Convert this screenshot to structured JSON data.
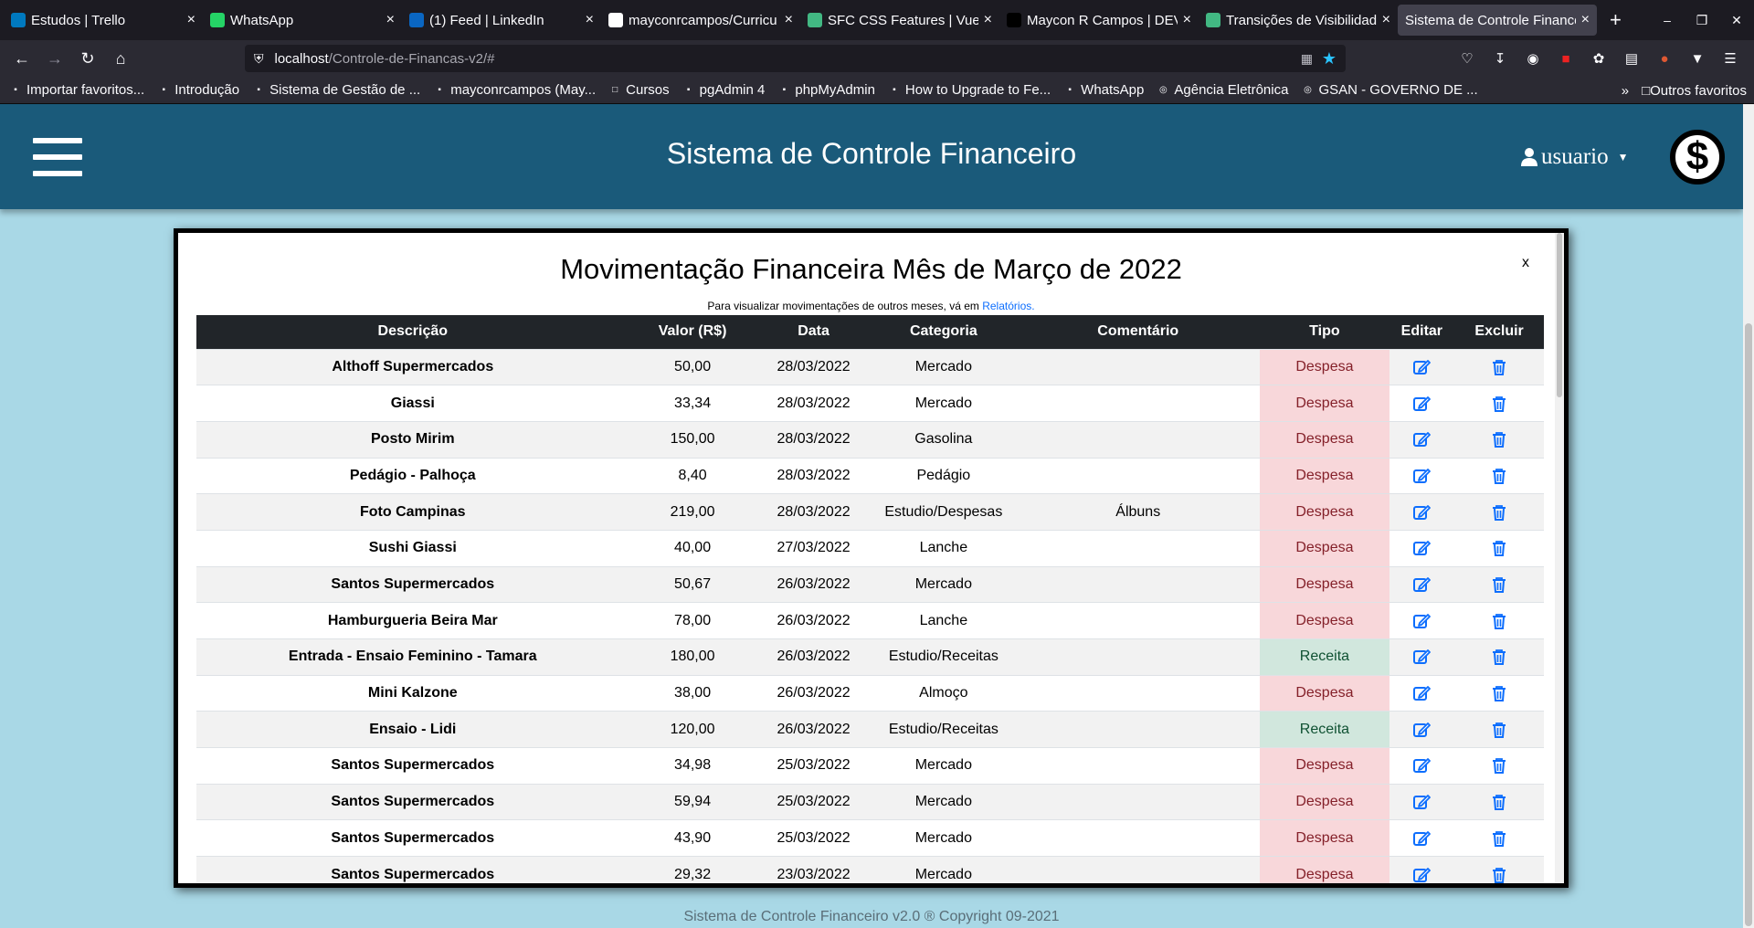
{
  "browser": {
    "tabs": [
      {
        "label": "Estudos | Trello",
        "icon": "trello-icon",
        "color": "#0079bf"
      },
      {
        "label": "WhatsApp",
        "icon": "whatsapp-icon",
        "color": "#25d366"
      },
      {
        "label": "(1) Feed | LinkedIn",
        "icon": "linkedin-icon",
        "color": "#0a66c2"
      },
      {
        "label": "mayconrcampos/Curricu",
        "icon": "github-icon",
        "color": "#ffffff"
      },
      {
        "label": "SFC CSS Features | Vue.js",
        "icon": "vue-icon",
        "color": "#42b883"
      },
      {
        "label": "Maycon R Campos | DEV Ful",
        "icon": "dev-icon",
        "color": "#000000"
      },
      {
        "label": "Transições de Visibilidad",
        "icon": "vue-icon",
        "color": "#42b883"
      },
      {
        "label": "Sistema de Controle Finance",
        "icon": "",
        "color": ""
      }
    ],
    "url_host": "localhost",
    "url_path": "/Controle-de-Financas-v2/#",
    "bookmarks": [
      {
        "label": "Importar favoritos...",
        "icon": "import-icon"
      },
      {
        "label": "Introdução",
        "icon": "firefox-icon"
      },
      {
        "label": "Sistema de Gestão de ...",
        "icon": "arrow-icon"
      },
      {
        "label": "mayconrcampos (May...",
        "icon": "github-icon"
      },
      {
        "label": "Cursos",
        "icon": "folder-icon"
      },
      {
        "label": "pgAdmin 4",
        "icon": "pg-icon"
      },
      {
        "label": "phpMyAdmin",
        "icon": "pma-icon"
      },
      {
        "label": "How to Upgrade to Fe...",
        "icon": "fedora-icon"
      },
      {
        "label": "WhatsApp",
        "icon": "whatsapp-icon"
      },
      {
        "label": "Agência Eletrônica",
        "icon": "globe-icon"
      },
      {
        "label": "GSAN - GOVERNO DE ...",
        "icon": "globe-icon"
      }
    ],
    "other_bookmarks": "Outros favoritos"
  },
  "app": {
    "title": "Sistema de Controle Financeiro",
    "user": "usuario",
    "logo_symbol": "$"
  },
  "modal": {
    "title": "Movimentação Financeira Mês de Março de 2022",
    "close": "x",
    "subtitle_prefix": "Para visualizar movimentações de outros meses, vá em ",
    "subtitle_link": "Relatórios.",
    "columns": [
      "Descrição",
      "Valor (R$)",
      "Data",
      "Categoria",
      "Comentário",
      "Tipo",
      "Editar",
      "Excluir"
    ],
    "rows": [
      {
        "descricao": "Althoff Supermercados",
        "valor": "50,00",
        "data": "28/03/2022",
        "categoria": "Mercado",
        "comentario": "",
        "tipo": "Despesa"
      },
      {
        "descricao": "Giassi",
        "valor": "33,34",
        "data": "28/03/2022",
        "categoria": "Mercado",
        "comentario": "",
        "tipo": "Despesa"
      },
      {
        "descricao": "Posto Mirim",
        "valor": "150,00",
        "data": "28/03/2022",
        "categoria": "Gasolina",
        "comentario": "",
        "tipo": "Despesa"
      },
      {
        "descricao": "Pedágio - Palhoça",
        "valor": "8,40",
        "data": "28/03/2022",
        "categoria": "Pedágio",
        "comentario": "",
        "tipo": "Despesa"
      },
      {
        "descricao": "Foto Campinas",
        "valor": "219,00",
        "data": "28/03/2022",
        "categoria": "Estudio/Despesas",
        "comentario": "Álbuns",
        "tipo": "Despesa"
      },
      {
        "descricao": "Sushi Giassi",
        "valor": "40,00",
        "data": "27/03/2022",
        "categoria": "Lanche",
        "comentario": "",
        "tipo": "Despesa"
      },
      {
        "descricao": "Santos Supermercados",
        "valor": "50,67",
        "data": "26/03/2022",
        "categoria": "Mercado",
        "comentario": "",
        "tipo": "Despesa"
      },
      {
        "descricao": "Hamburgueria Beira Mar",
        "valor": "78,00",
        "data": "26/03/2022",
        "categoria": "Lanche",
        "comentario": "",
        "tipo": "Despesa"
      },
      {
        "descricao": "Entrada - Ensaio Feminino - Tamara",
        "valor": "180,00",
        "data": "26/03/2022",
        "categoria": "Estudio/Receitas",
        "comentario": "",
        "tipo": "Receita"
      },
      {
        "descricao": "Mini Kalzone",
        "valor": "38,00",
        "data": "26/03/2022",
        "categoria": "Almoço",
        "comentario": "",
        "tipo": "Despesa"
      },
      {
        "descricao": "Ensaio - Lidi",
        "valor": "120,00",
        "data": "26/03/2022",
        "categoria": "Estudio/Receitas",
        "comentario": "",
        "tipo": "Receita"
      },
      {
        "descricao": "Santos Supermercados",
        "valor": "34,98",
        "data": "25/03/2022",
        "categoria": "Mercado",
        "comentario": "",
        "tipo": "Despesa"
      },
      {
        "descricao": "Santos Supermercados",
        "valor": "59,94",
        "data": "25/03/2022",
        "categoria": "Mercado",
        "comentario": "",
        "tipo": "Despesa"
      },
      {
        "descricao": "Santos Supermercados",
        "valor": "43,90",
        "data": "25/03/2022",
        "categoria": "Mercado",
        "comentario": "",
        "tipo": "Despesa"
      },
      {
        "descricao": "Santos Supermercados",
        "valor": "29,32",
        "data": "23/03/2022",
        "categoria": "Mercado",
        "comentario": "",
        "tipo": "Despesa"
      }
    ]
  },
  "footer": "Sistema de Controle Financeiro v2.0 ® Copyright 09-2021",
  "colors": {
    "header_bg": "#1a5a7a",
    "page_bg": "#a9d8e6",
    "icon_blue": "#0d6efd",
    "despesa_bg": "#f8d7da",
    "receita_bg": "#d1e7dd"
  }
}
